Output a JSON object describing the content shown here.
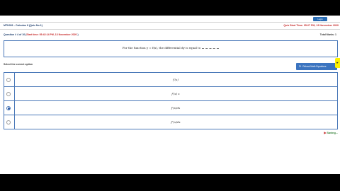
{
  "header": {
    "login_label": "Login",
    "course_title": "MTH301 - Calculus II (Quiz No.1)",
    "quiz_start_time": "Quiz Start Time: 05:27 PM, 13 November 2020"
  },
  "question": {
    "number_label": "Question # 4 of 10 (",
    "start_time": "Start time: 05:42:14 PM, 13 November 2020",
    "close_paren": " )",
    "marks_label": "Total Marks: 1",
    "text": "For the function y = f(x), the differential dy is equal to"
  },
  "select_label": "Select the correct option",
  "reload_button": {
    "label": "Reload Math Equations",
    "icon": "refresh-icon"
  },
  "side_tab_icon": "pointer-icon",
  "options": [
    {
      "text": "f′(x)",
      "selected": false
    },
    {
      "text": "f′(x) x",
      "selected": false
    },
    {
      "text": "f′(x)dx",
      "selected": true
    },
    {
      "text": "f″(x)dx",
      "selected": false
    }
  ],
  "status": {
    "saving_label": "Saving..."
  },
  "colors": {
    "accent": "#4a78b8",
    "alert": "#c62828",
    "success": "#2e7d32"
  }
}
